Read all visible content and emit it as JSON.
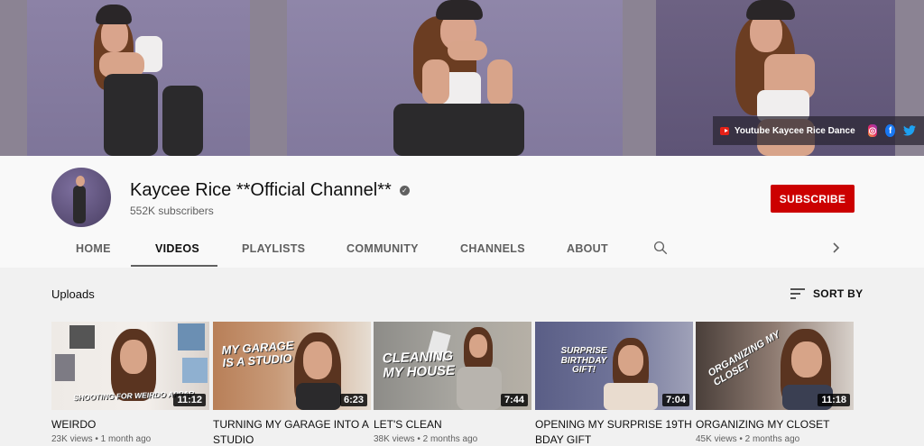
{
  "banner": {
    "social_label": "Youtube Kaycee Rice Dance",
    "icons": [
      "youtube-icon",
      "instagram-icon",
      "facebook-icon",
      "twitter-icon"
    ]
  },
  "channel": {
    "title": "Kaycee Rice **Official Channel**",
    "subscribers": "552K subscribers",
    "subscribe_label": "SUBSCRIBE"
  },
  "tabs": [
    {
      "label": "HOME"
    },
    {
      "label": "VIDEOS"
    },
    {
      "label": "PLAYLISTS"
    },
    {
      "label": "COMMUNITY"
    },
    {
      "label": "CHANNELS"
    },
    {
      "label": "ABOUT"
    }
  ],
  "active_tab": "VIDEOS",
  "section": {
    "title": "Uploads",
    "sort_label": "SORT BY"
  },
  "videos": [
    {
      "title": "WEIRDO",
      "duration": "11:12",
      "meta": "23K views • 1 month ago",
      "thumb_text": "SHOOTING FOR WEIRDO APPAR"
    },
    {
      "title": "TURNING MY GARAGE INTO A STUDIO",
      "duration": "6:23",
      "meta": "",
      "thumb_text": "MY GARAGE IS A STUDIO"
    },
    {
      "title": "LET'S CLEAN",
      "duration": "7:44",
      "meta": "38K views • 2 months ago",
      "thumb_text": "CLEANING MY HOUSE"
    },
    {
      "title": "OPENING MY SURPRISE 19th BDAY GIFT",
      "duration": "7:04",
      "meta": "",
      "thumb_text": "SURPRISE BIRTHDAY GIFT!"
    },
    {
      "title": "ORGANIZING MY CLOSET",
      "duration": "11:18",
      "meta": "45K views • 2 months ago",
      "thumb_text": "ORGANIZING MY CLOSET"
    }
  ],
  "colors": {
    "subscribe": "#cc0000",
    "banner": "#8a7fa6"
  }
}
